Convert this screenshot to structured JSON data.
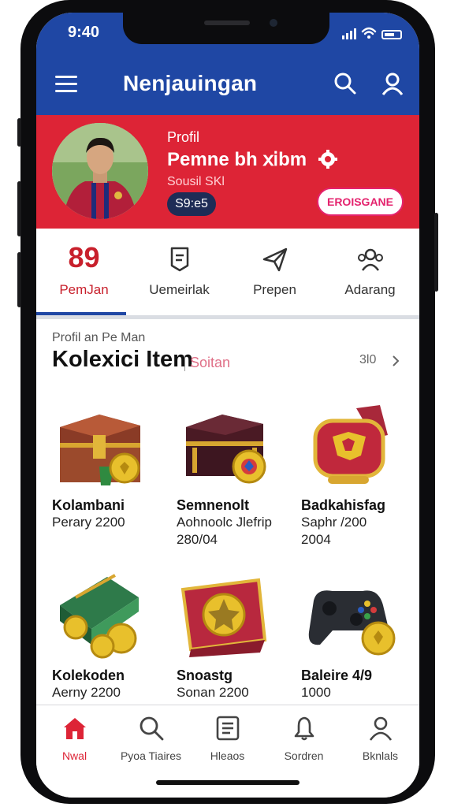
{
  "status_bar": {
    "time": "9:40"
  },
  "app_bar": {
    "title": "Nenjauingan"
  },
  "profile": {
    "label": "Profil",
    "name": "Pemne bh ⅺbm",
    "subtitle": "Sousil SKl",
    "level": "S9:e5",
    "edit_button": "EROISGANE"
  },
  "stat_tabs": [
    {
      "value": "89",
      "label": "PemJan",
      "active": true
    },
    {
      "label": "Uemeirlak",
      "icon": "badge-icon"
    },
    {
      "label": "Prepen",
      "icon": "paper-plane-icon"
    },
    {
      "label": "Adarang",
      "icon": "team-icon"
    }
  ],
  "collection": {
    "subtitle": "Profil an Pe Man",
    "title": "Kolexici Item",
    "tag": "Soitan",
    "see_all": "3l0"
  },
  "items": [
    {
      "name": "Kolambani",
      "lines": [
        "Perary 2200"
      ],
      "icon": "treasure-chest-icon"
    },
    {
      "name": "Semnenolt",
      "lines": [
        "Aohnoolc Jlefrip",
        "280/04"
      ],
      "icon": "dark-chest-icon"
    },
    {
      "name": "Badkahisfag",
      "lines": [
        "Saphr /200",
        "2004"
      ],
      "icon": "red-bag-icon"
    },
    {
      "name": "Kolekoden",
      "lines": [
        "Aerny 2200"
      ],
      "icon": "cash-coins-icon"
    },
    {
      "name": "Snoastg",
      "lines": [
        "Sonan 2200"
      ],
      "icon": "star-chest-icon"
    },
    {
      "name": "Baleire 4/9",
      "lines": [
        "1000"
      ],
      "icon": "gamepad-icon"
    }
  ],
  "bottom_nav": [
    {
      "label": "Nwal",
      "icon": "home-icon",
      "active": true
    },
    {
      "label": "Pyoa Tiaires",
      "icon": "search-icon"
    },
    {
      "label": "Hleaos",
      "icon": "list-icon"
    },
    {
      "label": "Sordren",
      "icon": "bell-icon"
    },
    {
      "label": "Bknlals",
      "icon": "user-icon"
    }
  ],
  "colors": {
    "app_bar": "#1f47a4",
    "profile_band": "#dd2436",
    "accent_pink": "#e4226d",
    "active_red": "#c8202c"
  }
}
